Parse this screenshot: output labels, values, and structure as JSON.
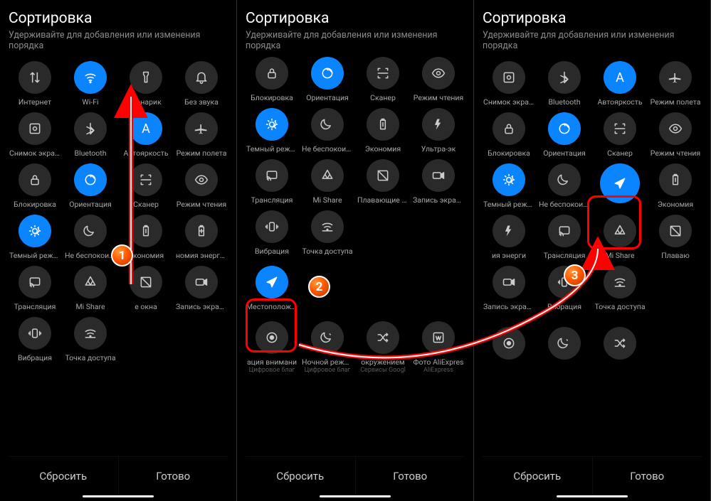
{
  "shared": {
    "title": "Сортировка",
    "subtitle": "Удерживайте для добавления или изменения порядка",
    "reset": "Сбросить",
    "done": "Готово"
  },
  "panel1": {
    "tiles": [
      {
        "icon": "updown",
        "label": "Интернет"
      },
      {
        "icon": "wifi",
        "label": "Wi-Fi",
        "on": true
      },
      {
        "icon": "flashlight",
        "label": "Фонарик"
      },
      {
        "icon": "bell",
        "label": "Без звука"
      },
      {
        "icon": "screenshot",
        "label": "Снимок экрана"
      },
      {
        "icon": "bluetooth",
        "label": "Bluetooth"
      },
      {
        "icon": "autobright",
        "label": "Автояркость",
        "on": true
      },
      {
        "icon": "airplane",
        "label": "Режим полета"
      },
      {
        "icon": "lock",
        "label": "Блокировка"
      },
      {
        "icon": "orientation",
        "label": "Ориентация",
        "on": true
      },
      {
        "icon": "scanner",
        "label": "Сканер"
      },
      {
        "icon": "eye",
        "label": "Режим чтения"
      },
      {
        "icon": "darkmode",
        "label": "Темный режим",
        "on": true
      },
      {
        "icon": "dnd",
        "label": "Не беспокоить"
      },
      {
        "icon": "battery",
        "label": "Экономия"
      },
      {
        "icon": "batteryplus",
        "label": "номия энергии"
      },
      {
        "icon": "cast",
        "label": "Трансляция"
      },
      {
        "icon": "mishare",
        "label": "Mi Share"
      },
      {
        "icon": "float",
        "label": "е окна"
      },
      {
        "icon": "record",
        "label": "Запись экрана"
      },
      {
        "icon": "vibration",
        "label": "Вибрация"
      },
      {
        "icon": "hotspot",
        "label": "Точка доступа"
      }
    ]
  },
  "panel2": {
    "topTiles": [
      {
        "icon": "lock",
        "label": "Блокировка"
      },
      {
        "icon": "orientation",
        "label": "Ориентация",
        "on": true
      },
      {
        "icon": "scanner",
        "label": "Сканер"
      },
      {
        "icon": "eye",
        "label": "Режим чтения"
      },
      {
        "icon": "darkmode",
        "label": "Темный режим",
        "on": true
      },
      {
        "icon": "dnd",
        "label": "Не беспокоить"
      },
      {
        "icon": "battery",
        "label": "Экономия"
      },
      {
        "icon": "ultra",
        "label": "Ультра-эк"
      },
      {
        "icon": "cast",
        "label": "Трансляция"
      },
      {
        "icon": "mishare",
        "label": "Mi Share"
      },
      {
        "icon": "float",
        "label": "Плавающие ок"
      },
      {
        "icon": "record",
        "label": "Запись экрана"
      },
      {
        "icon": "vibration",
        "label": "Вибрация"
      },
      {
        "icon": "hotspot",
        "label": "Точка доступа"
      }
    ],
    "extraTile": {
      "icon": "location",
      "label": "Местоположен",
      "on": true
    },
    "bottomTiles": [
      {
        "icon": "focus",
        "label": "ация внимани",
        "sub": "Цифровое благ"
      },
      {
        "icon": "nightmode",
        "label": "Ночной режим",
        "sub": "Цифровое благ"
      },
      {
        "icon": "shuffle",
        "label": "окружением",
        "sub": "Сервисы Googl"
      },
      {
        "icon": "aliexpress",
        "label": "Фото AliExpres",
        "sub": "AliExpress"
      }
    ]
  },
  "panel3": {
    "tiles": [
      {
        "icon": "screenshot",
        "label": "Снимок экрана"
      },
      {
        "icon": "bluetooth",
        "label": "Bluetooth"
      },
      {
        "icon": "autobright",
        "label": "Автояркость",
        "on": true
      },
      {
        "icon": "airplane",
        "label": "Режим полета"
      },
      {
        "icon": "lock",
        "label": "Блокировка"
      },
      {
        "icon": "orientation",
        "label": "Ориентация",
        "on": true
      },
      {
        "icon": "scanner",
        "label": "Сканер"
      },
      {
        "icon": "eye",
        "label": "Режим чтения"
      },
      {
        "icon": "darkmode",
        "label": "Темный режим",
        "on": true
      },
      {
        "icon": "dnd",
        "label": "Не беспокоить"
      },
      {
        "icon": "location",
        "label": "",
        "on": true,
        "big": true
      },
      {
        "icon": "battery",
        "label": "Экономия"
      },
      {
        "icon": "ultra",
        "label": "ия энерги"
      },
      {
        "icon": "cast",
        "label": "Трансляция"
      },
      {
        "icon": "mishare",
        "label": "Mi Share"
      },
      {
        "icon": "float",
        "label": "Плаваю"
      },
      {
        "icon": "record",
        "label": "Запись экрана"
      },
      {
        "icon": "vibration",
        "label": "Вибрация"
      },
      {
        "icon": "hotspot",
        "label": "Точка доступа"
      }
    ],
    "bottomTiles": [
      {
        "icon": "focus",
        "label": ""
      },
      {
        "icon": "nightmode",
        "label": ""
      },
      {
        "icon": "shuffle",
        "label": ""
      }
    ]
  },
  "steps": {
    "1": "1",
    "2": "2",
    "3": "3"
  }
}
